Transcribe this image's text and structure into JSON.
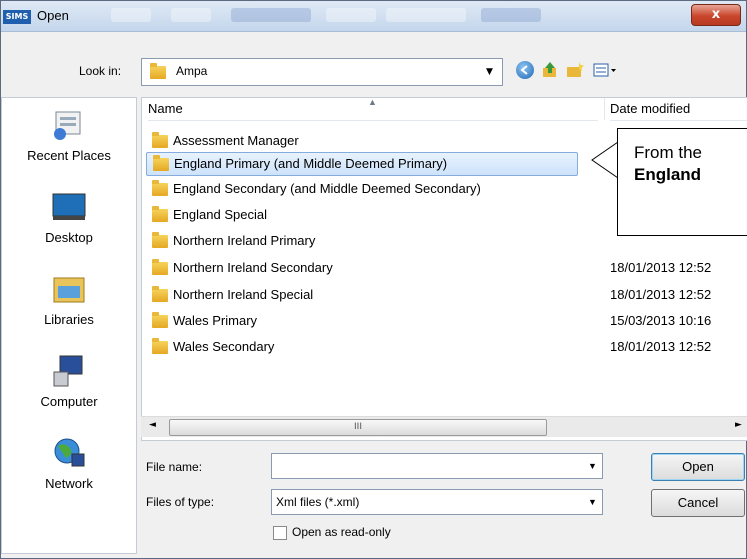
{
  "window": {
    "title": "Open",
    "app_badge": "SIMS",
    "close_glyph": "x"
  },
  "toolbar": {
    "look_in_label": "Look in:",
    "look_in_value": "Ampa",
    "icons": [
      "back-icon",
      "up-folder-icon",
      "new-folder-icon",
      "view-menu-icon"
    ]
  },
  "places": [
    {
      "label": "Recent Places",
      "icon": "recent-places-icon"
    },
    {
      "label": "Desktop",
      "icon": "desktop-icon"
    },
    {
      "label": "Libraries",
      "icon": "libraries-icon"
    },
    {
      "label": "Computer",
      "icon": "computer-icon"
    },
    {
      "label": "Network",
      "icon": "network-icon"
    }
  ],
  "filelist": {
    "columns": {
      "name": "Name",
      "date": "Date modified"
    },
    "rows": [
      {
        "name": "Assessment Manager",
        "date": ""
      },
      {
        "name": "England Primary (and Middle Deemed Primary)",
        "date": "",
        "selected": true
      },
      {
        "name": "England Secondary (and Middle Deemed Secondary)",
        "date": ""
      },
      {
        "name": "England Special",
        "date": ""
      },
      {
        "name": "Northern Ireland Primary",
        "date": ""
      },
      {
        "name": "Northern Ireland Secondary",
        "date": "18/01/2013 12:52"
      },
      {
        "name": "Northern Ireland Special",
        "date": "18/01/2013 12:52"
      },
      {
        "name": "Wales Primary",
        "date": "15/03/2013 10:16"
      },
      {
        "name": "Wales Secondary",
        "date": "18/01/2013 12:52"
      }
    ],
    "scroll_thumb_grip": "III"
  },
  "form": {
    "file_name_label": "File name:",
    "file_name_value": "",
    "files_of_type_label": "Files of type:",
    "files_of_type_value": "Xml files (*.xml)",
    "readonly_label": "Open as read-only",
    "open_button": "Open",
    "cancel_button": "Cancel"
  },
  "callout": {
    "text": "From the",
    "bold_text": "England"
  }
}
